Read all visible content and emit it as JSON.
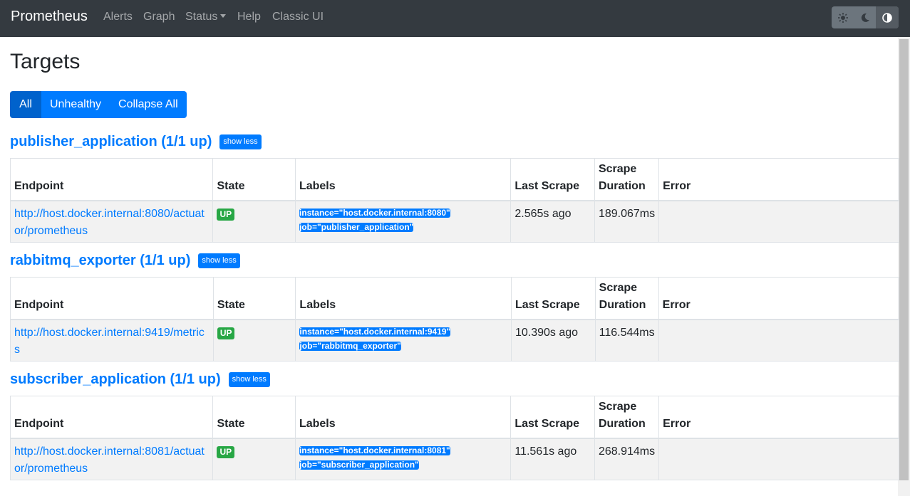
{
  "navbar": {
    "brand": "Prometheus",
    "links": [
      "Alerts",
      "Graph",
      "Status",
      "Help",
      "Classic UI"
    ],
    "theme_buttons": [
      "sun-icon",
      "moon-icon",
      "half-circle-icon"
    ]
  },
  "page": {
    "title": "Targets",
    "filters": [
      "All",
      "Unhealthy",
      "Collapse All"
    ]
  },
  "table_headers": [
    "Endpoint",
    "State",
    "Labels",
    "Last Scrape",
    "Scrape Duration",
    "Error"
  ],
  "jobs": [
    {
      "title": "publisher_application (1/1 up)",
      "toggle": "show less",
      "row": {
        "endpoint": "http://host.docker.internal:8080/actuator/prometheus",
        "state": "UP",
        "labels": [
          "instance=\"host.docker.internal:8080\"",
          "job=\"publisher_application\""
        ],
        "last_scrape": "2.565s ago",
        "duration": "189.067ms",
        "error": ""
      }
    },
    {
      "title": "rabbitmq_exporter (1/1 up)",
      "toggle": "show less",
      "row": {
        "endpoint": "http://host.docker.internal:9419/metrics",
        "state": "UP",
        "labels": [
          "instance=\"host.docker.internal:9419\"",
          "job=\"rabbitmq_exporter\""
        ],
        "last_scrape": "10.390s ago",
        "duration": "116.544ms",
        "error": ""
      }
    },
    {
      "title": "subscriber_application (1/1 up)",
      "toggle": "show less",
      "row": {
        "endpoint": "http://host.docker.internal:8081/actuator/prometheus",
        "state": "UP",
        "labels": [
          "instance=\"host.docker.internal:8081\"",
          "job=\"subscriber_application\""
        ],
        "last_scrape": "11.561s ago",
        "duration": "268.914ms",
        "error": ""
      }
    }
  ],
  "colors": {
    "navbar": "#343a40",
    "primary": "#007bff",
    "success": "#28a745"
  }
}
